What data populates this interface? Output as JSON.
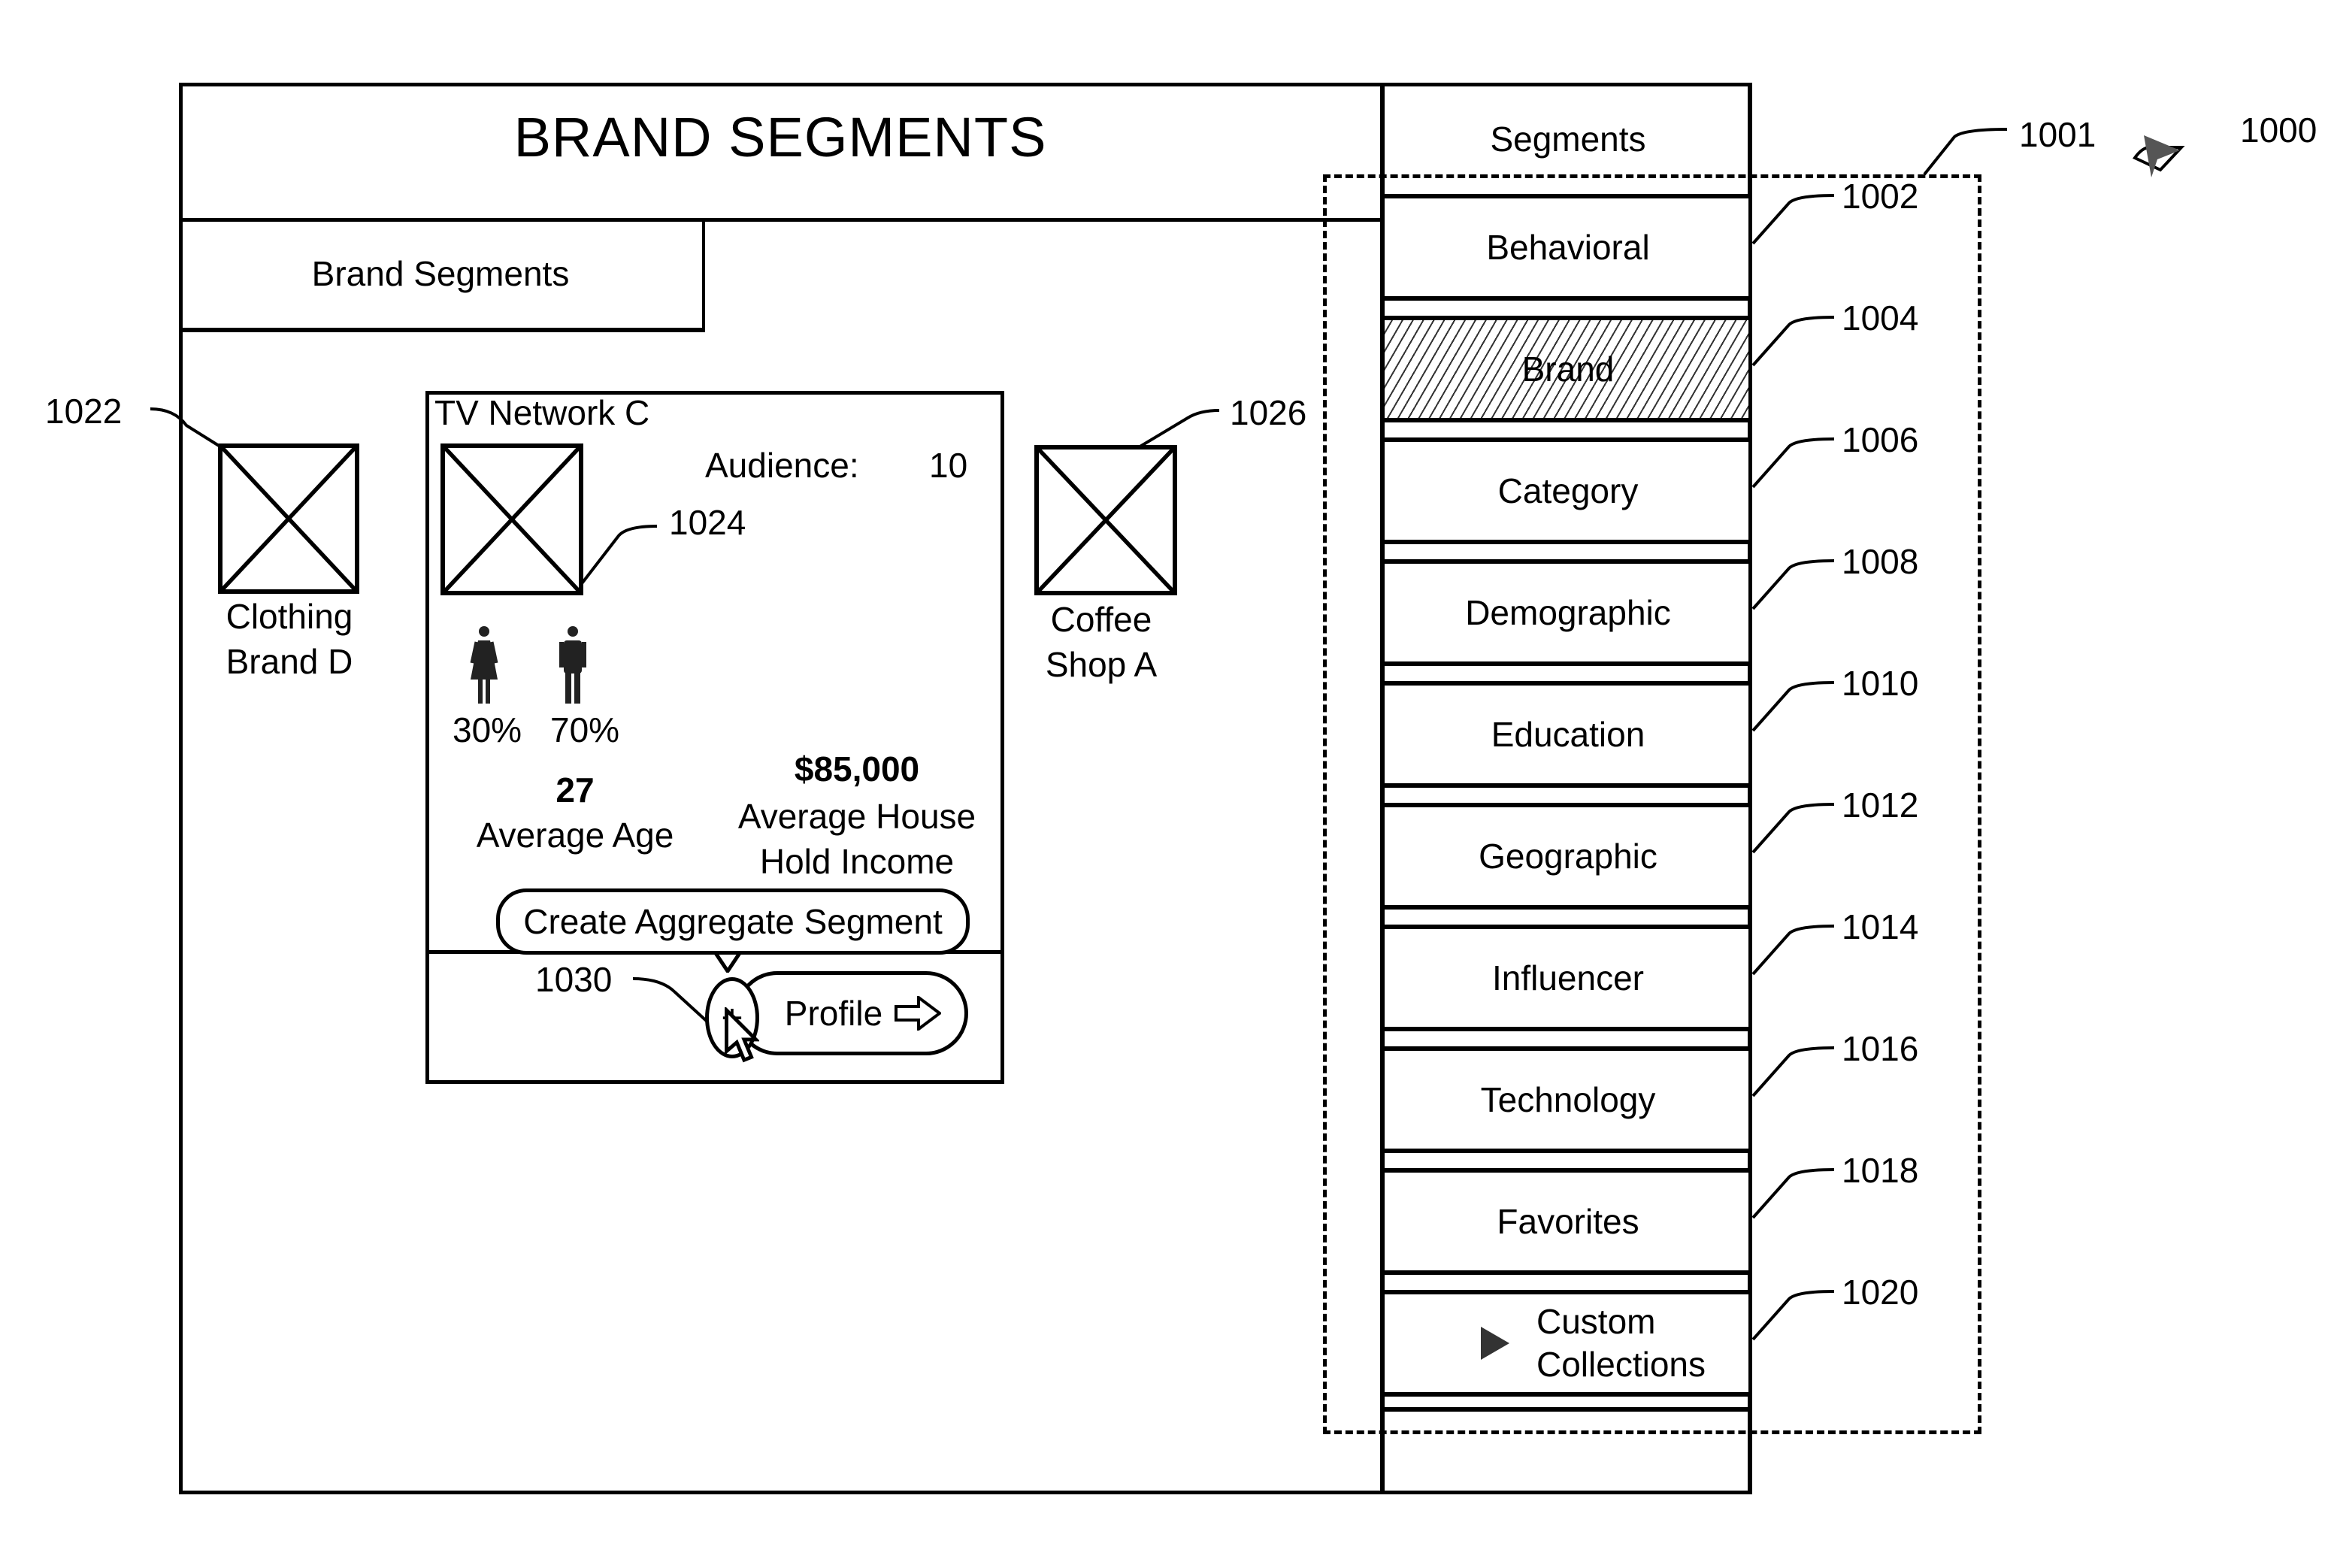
{
  "figure_number": "1000",
  "app": {
    "title": "BRAND SEGMENTS",
    "tab_label": "Brand Segments"
  },
  "sidebar": {
    "header": "Segments",
    "region_ref": "1001",
    "selected": "Brand",
    "items": [
      {
        "label": "Behavioral",
        "ref": "1002",
        "selected": false
      },
      {
        "label": "Brand",
        "ref": "1004",
        "selected": true
      },
      {
        "label": "Category",
        "ref": "1006",
        "selected": false
      },
      {
        "label": "Demographic",
        "ref": "1008",
        "selected": false
      },
      {
        "label": "Education",
        "ref": "1010",
        "selected": false
      },
      {
        "label": "Geographic",
        "ref": "1012",
        "selected": false
      },
      {
        "label": "Influencer",
        "ref": "1014",
        "selected": false
      },
      {
        "label": "Technology",
        "ref": "1016",
        "selected": false
      },
      {
        "label": "Favorites",
        "ref": "1018",
        "selected": false
      },
      {
        "label_line1": "Custom",
        "label_line2": "Collections",
        "ref": "1020",
        "selected": false,
        "icon": "triangle-right-icon"
      }
    ]
  },
  "brands": [
    {
      "name_line1": "Clothing",
      "name_line2": "Brand D",
      "ref": "1022"
    },
    {
      "name_line1": "Coffee",
      "name_line2": "Shop A",
      "ref": "1026"
    }
  ],
  "card": {
    "title": "TV Network C",
    "image_ref": "1024",
    "audience_label": "Audience:",
    "audience_value": "10",
    "female_pct": "30%",
    "male_pct": "70%",
    "avg_age_value": "27",
    "avg_age_label": "Average Age",
    "income_value": "$85,000",
    "income_label_line1": "Average House",
    "income_label_line2": "Hold Income",
    "tooltip": "Create Aggregate Segment",
    "add_button": "+",
    "add_button_ref": "1030",
    "profile_label": "Profile"
  }
}
